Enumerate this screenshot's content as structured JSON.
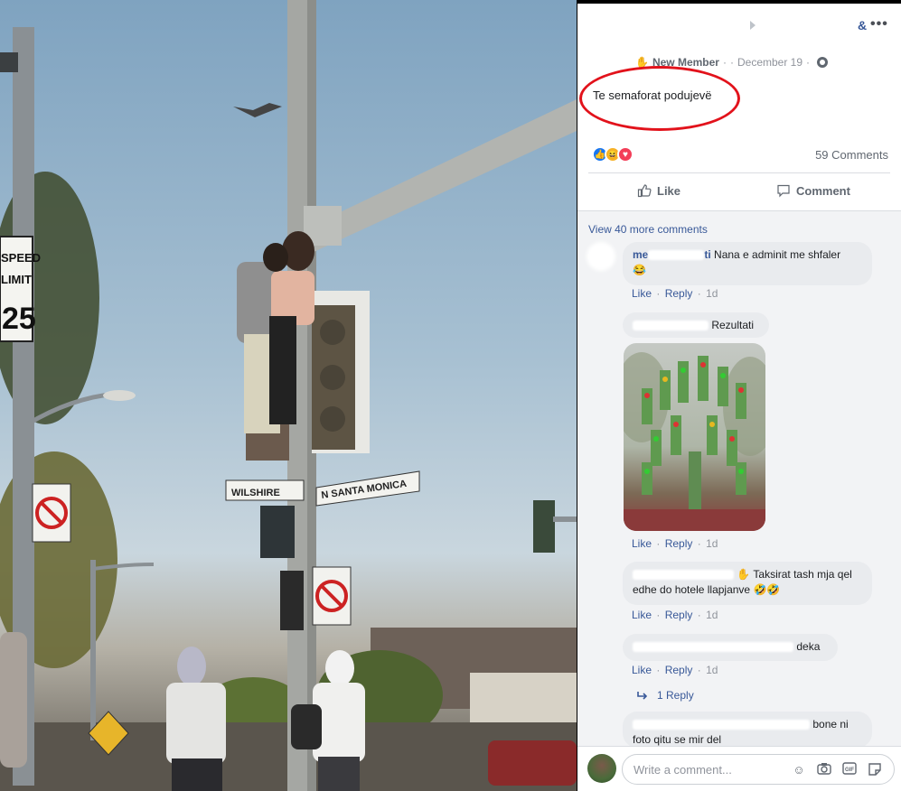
{
  "post": {
    "badge": "New Member",
    "separator": "·",
    "date": "December 19",
    "text": "Te semaforat podujevë",
    "comment_count": "59 Comments",
    "actions": {
      "like": "Like",
      "comment": "Comment"
    }
  },
  "header": {
    "ampersand": "&",
    "more": "•••"
  },
  "comments": {
    "view_more": "View 40 more comments",
    "items": [
      {
        "name": "me",
        "tail": "ti",
        "text": "Nana e adminit me shfaler",
        "emoji": "😂",
        "like": "Like",
        "reply": "Reply",
        "dot": "·",
        "time": "1d"
      },
      {
        "text": "Rezultati",
        "like": "Like",
        "reply": "Reply",
        "dot": "·",
        "time": "1d"
      },
      {
        "text": "Taksirat tash mja qel edhe do hotele llapjanve",
        "emoji": "🤣🤣",
        "like": "Like",
        "reply": "Reply",
        "dot": "·",
        "time": "1d"
      },
      {
        "text": "deka",
        "like": "Like",
        "reply": "Reply",
        "dot": "·",
        "time": "1d"
      },
      {
        "text_a": "bone ni",
        "text_b": "foto qitu se mir del"
      }
    ],
    "reply_link": "1 Reply"
  },
  "photo_signs": {
    "speed_top": "SPEED",
    "speed_mid": "LIMIT",
    "speed_val": "25",
    "street_a": "WILSHIRE",
    "street_b": "N SANTA MONICA"
  },
  "compose": {
    "placeholder": "Write a comment..."
  },
  "colors": {
    "link": "#385898",
    "highlight": "#e2121b",
    "bubble": "#e9ebee"
  }
}
